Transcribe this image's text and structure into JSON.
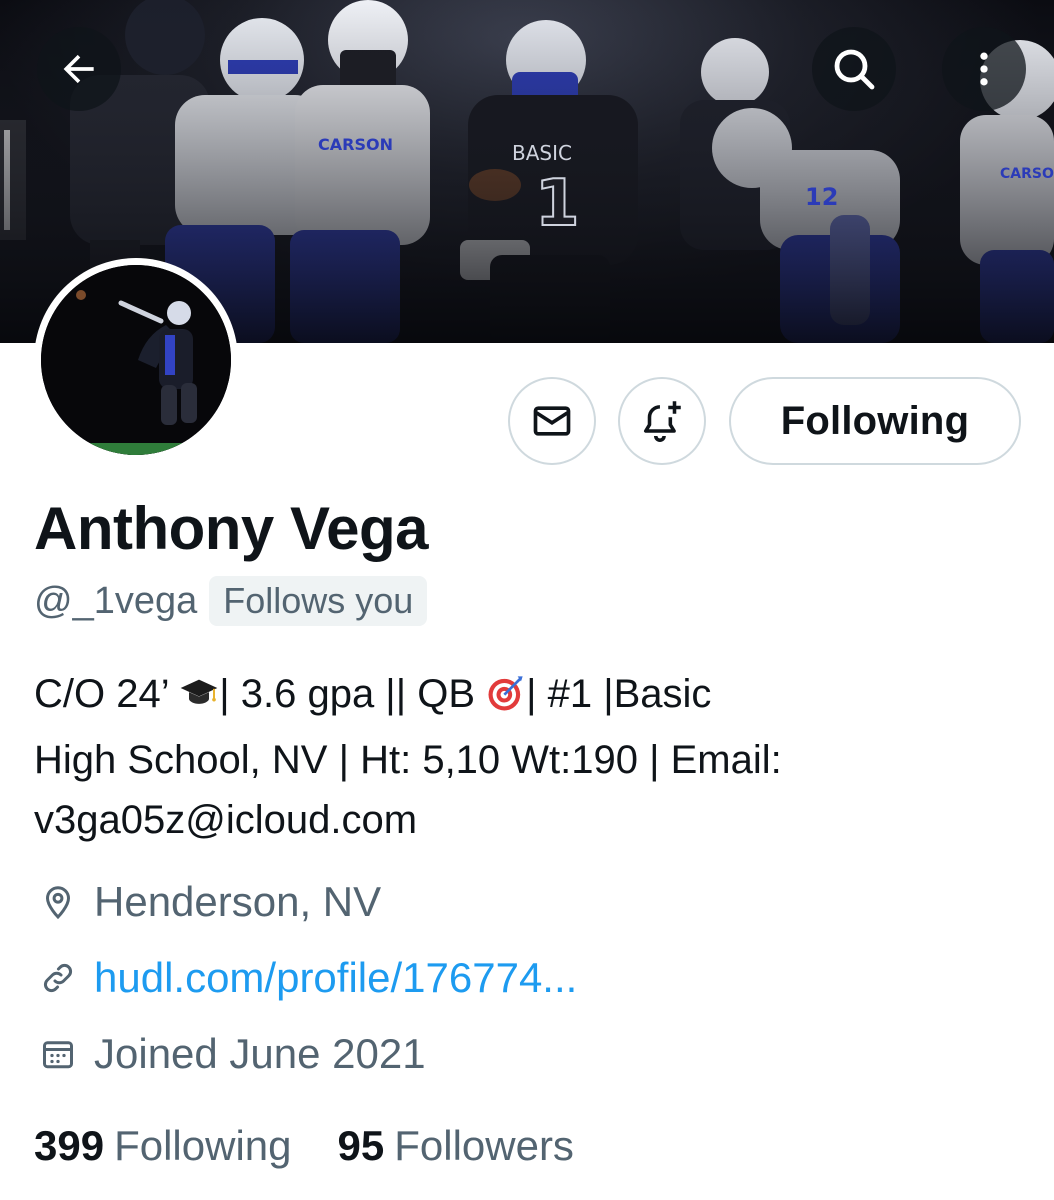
{
  "header": {
    "back_icon": "arrow-left-icon",
    "search_icon": "search-icon",
    "more_icon": "more-vertical-icon",
    "banner_jersey_texts": [
      "BASIC",
      "1",
      "CARSON",
      "CARSON",
      "12"
    ]
  },
  "actions": {
    "message_icon": "envelope-icon",
    "notify_icon": "bell-plus-icon",
    "follow_label": "Following"
  },
  "profile": {
    "name": "Anthony Vega",
    "handle": "@_1vega",
    "follows_you": "Follows you",
    "bio_line1_a": "C/O 24’ ",
    "bio_line1_b": "| 3.6 gpa || QB ",
    "bio_line1_c": "| #1 |Basic",
    "bio_line2": "High School, NV | Ht: 5,10 Wt:190 | Email:",
    "bio_line3": "v3ga05z@icloud.com",
    "bio_emojis": [
      "graduation-cap-icon",
      "direct-hit-icon"
    ],
    "location": "Henderson, NV",
    "website": "hudl.com/profile/176774...",
    "joined": "Joined June 2021"
  },
  "stats": {
    "following_count": "399",
    "following_label": "Following",
    "followers_count": "95",
    "followers_label": "Followers"
  },
  "colors": {
    "accent_link": "#1d9bf0",
    "secondary_text": "#536471",
    "primary_text": "#0f1419",
    "border": "#cfd9de",
    "team_blue": "#2f3fc8"
  }
}
